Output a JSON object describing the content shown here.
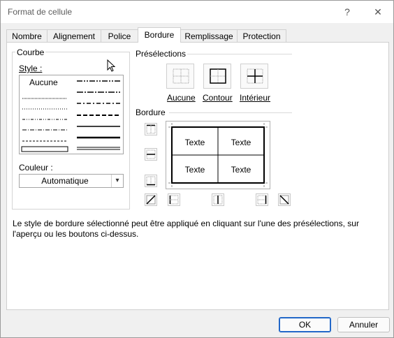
{
  "window": {
    "title": "Format de cellule",
    "help_glyph": "?",
    "close_glyph": "✕"
  },
  "tabs": [
    {
      "label": "Nombre"
    },
    {
      "label": "Alignement"
    },
    {
      "label": "Police"
    },
    {
      "label": "Bordure",
      "selected": true
    },
    {
      "label": "Remplissage"
    },
    {
      "label": "Protection"
    }
  ],
  "courbe": {
    "group_label": "Courbe",
    "style_label": "Style :",
    "style_none": "Aucune",
    "color_label": "Couleur :",
    "color_value": "Automatique"
  },
  "presets": {
    "group_label": "Présélections",
    "items": [
      {
        "label": "Aucune"
      },
      {
        "label": "Contour"
      },
      {
        "label": "Intérieur"
      }
    ]
  },
  "border": {
    "group_label": "Bordure",
    "preview_cells": [
      "Texte",
      "Texte",
      "Texte",
      "Texte"
    ]
  },
  "hint": "Le style de bordure sélectionné peut être appliqué en cliquant sur l'une des présélections, sur l'aperçu ou les boutons ci-dessus.",
  "buttons": {
    "ok": "OK",
    "cancel": "Annuler"
  }
}
